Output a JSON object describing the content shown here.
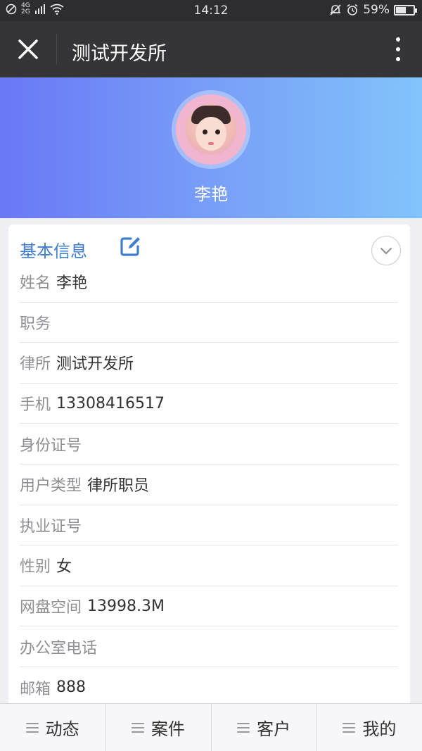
{
  "status_bar": {
    "network_label_top": "4G",
    "network_label_bottom": "2G",
    "time": "14:12",
    "battery_percent_text": "59%",
    "battery_level": 0.59,
    "icons": [
      "no-sim-icon",
      "signal-icon",
      "wifi-icon",
      "mute-icon",
      "alarm-icon",
      "battery-icon"
    ]
  },
  "title_bar": {
    "title": "测试开发所",
    "close_icon": "close-icon",
    "more_icon": "more-vertical-icon"
  },
  "profile": {
    "name": "李艳",
    "avatar": "avatar-photo"
  },
  "basic_info": {
    "title": "基本信息",
    "edit_icon": "edit-icon",
    "collapse_icon": "chevron-down-icon",
    "fields": [
      {
        "label": "姓名",
        "value": "李艳"
      },
      {
        "label": "职务",
        "value": ""
      },
      {
        "label": "律所",
        "value": "测试开发所"
      },
      {
        "label": "手机",
        "value": "13308416517"
      },
      {
        "label": "身份证号",
        "value": ""
      },
      {
        "label": "用户类型",
        "value": "律所职员"
      },
      {
        "label": "执业证号",
        "value": ""
      },
      {
        "label": "性别",
        "value": "女"
      },
      {
        "label": "网盘空间",
        "value": "13998.3M"
      },
      {
        "label": "办公室电话",
        "value": ""
      },
      {
        "label": "邮箱",
        "value": "888"
      }
    ]
  },
  "bottom_nav": {
    "items": [
      {
        "label": "动态"
      },
      {
        "label": "案件"
      },
      {
        "label": "客户"
      },
      {
        "label": "我的"
      }
    ]
  },
  "colors": {
    "accent": "#3f7ecf",
    "title_bar_bg": "#353538",
    "banner_gradient_start": "#6a78f6",
    "banner_gradient_end": "#82c4fb"
  }
}
